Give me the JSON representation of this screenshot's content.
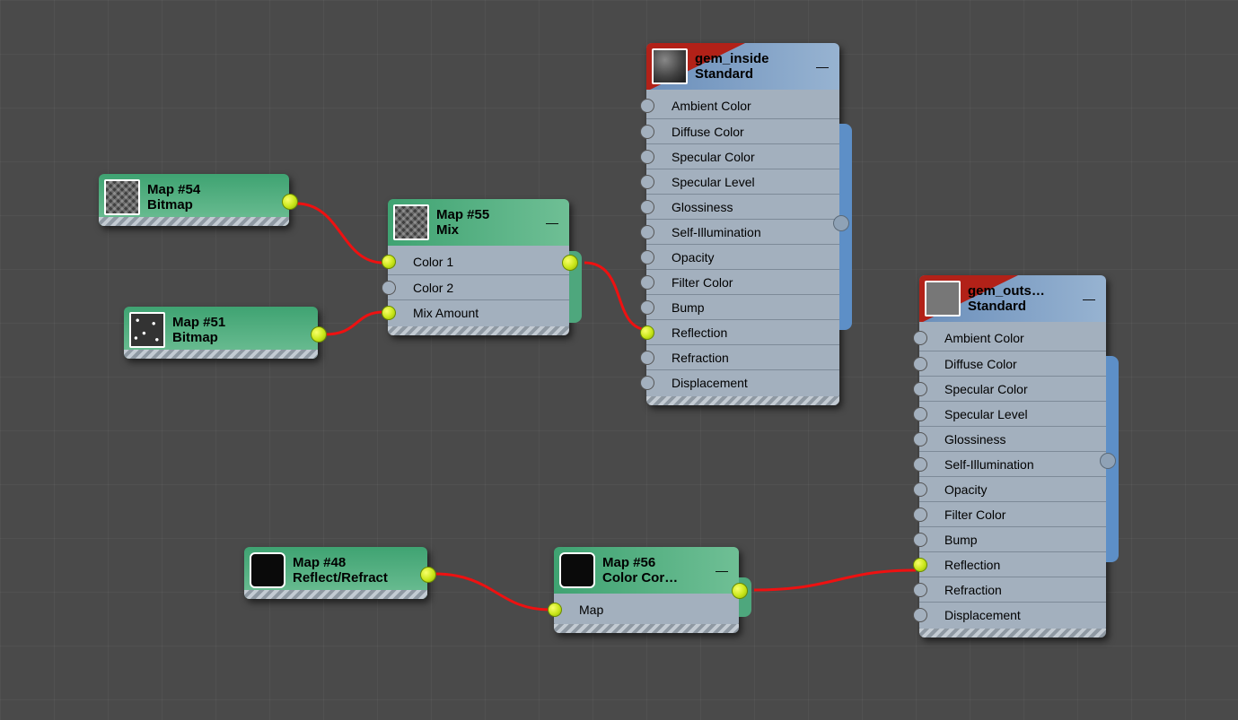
{
  "nodes": {
    "map54": {
      "title": "Map #54",
      "subtitle": "Bitmap"
    },
    "map51": {
      "title": "Map #51",
      "subtitle": "Bitmap"
    },
    "map55": {
      "title": "Map #55",
      "subtitle": "Mix",
      "slots": {
        "color1": "Color 1",
        "color2": "Color 2",
        "mixAmount": "Mix Amount"
      }
    },
    "map48": {
      "title": "Map #48",
      "subtitle": "Reflect/Refract"
    },
    "map56": {
      "title": "Map #56",
      "subtitle": "Color Cor…",
      "slots": {
        "map": "Map"
      }
    },
    "gemInside": {
      "title": "gem_inside",
      "subtitle": "Standard",
      "slots": {
        "ambient": "Ambient Color",
        "diffuse": "Diffuse Color",
        "specColor": "Specular Color",
        "specLevel": "Specular Level",
        "gloss": "Glossiness",
        "selfIllum": "Self-Illumination",
        "opacity": "Opacity",
        "filter": "Filter Color",
        "bump": "Bump",
        "reflection": "Reflection",
        "refraction": "Refraction",
        "displacement": "Displacement"
      }
    },
    "gemOutside": {
      "title": "gem_outs…",
      "subtitle": "Standard",
      "slots": {
        "ambient": "Ambient Color",
        "diffuse": "Diffuse Color",
        "specColor": "Specular Color",
        "specLevel": "Specular Level",
        "gloss": "Glossiness",
        "selfIllum": "Self-Illumination",
        "opacity": "Opacity",
        "filter": "Filter Color",
        "bump": "Bump",
        "reflection": "Reflection",
        "refraction": "Refraction",
        "displacement": "Displacement"
      }
    }
  },
  "collapseGlyph": "—"
}
